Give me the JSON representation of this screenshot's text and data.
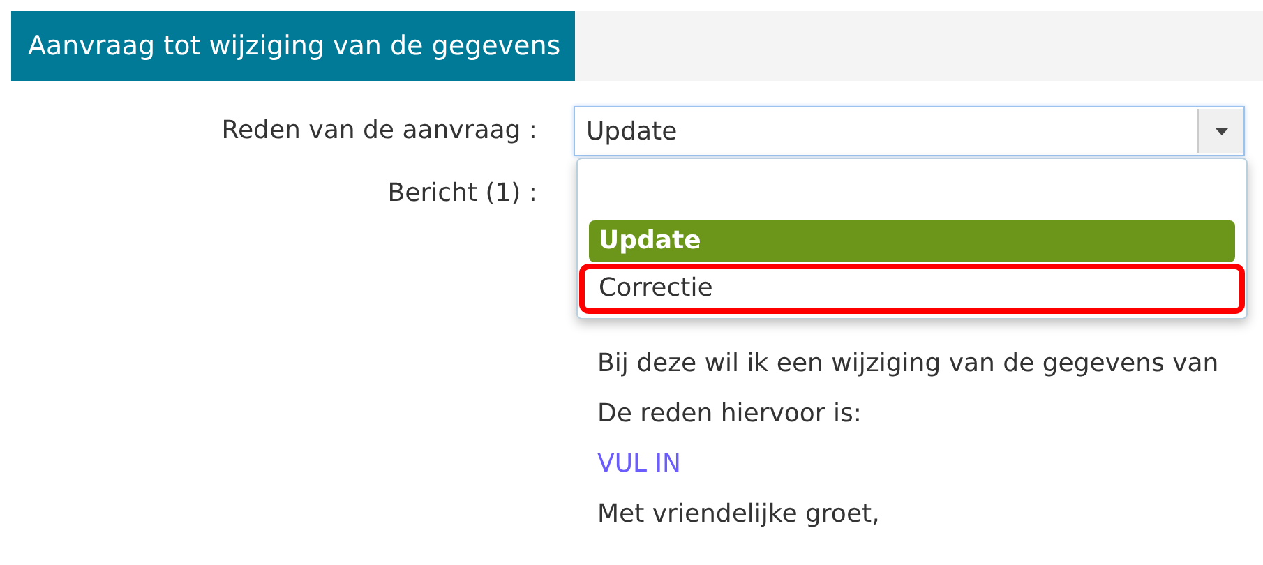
{
  "header": {
    "title": "Aanvraag tot wijziging van de gegevens"
  },
  "form": {
    "reason": {
      "label": "Reden van de aanvraag :",
      "value": "Update",
      "expanded": true,
      "options": [
        {
          "label": "Update",
          "selected": true,
          "outlined": false
        },
        {
          "label": "Correctie",
          "selected": false,
          "outlined": true
        }
      ]
    },
    "message": {
      "label": "Bericht (1) :",
      "lines": [
        {
          "kind": "text",
          "text": "Bij deze wil ik een wijziging van de gegevens van"
        },
        {
          "kind": "text",
          "text": "De reden hiervoor is:"
        },
        {
          "kind": "fill_in",
          "text": "VUL IN"
        },
        {
          "kind": "text",
          "text": "Met vriendelijke groet,"
        }
      ]
    }
  }
}
